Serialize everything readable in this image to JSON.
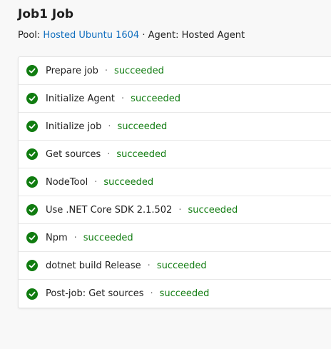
{
  "job": {
    "title": "Job1 Job",
    "pool_label": "Pool:",
    "pool_value": "Hosted Ubuntu 1604",
    "separator": "·",
    "agent_label": "Agent:",
    "agent_value": "Hosted Agent"
  },
  "colors": {
    "success": "#107c10",
    "link": "#106ebe"
  },
  "steps": [
    {
      "name": "Prepare job",
      "status": "succeeded",
      "icon": "check-circle-icon"
    },
    {
      "name": "Initialize Agent",
      "status": "succeeded",
      "icon": "check-circle-icon"
    },
    {
      "name": "Initialize job",
      "status": "succeeded",
      "icon": "check-circle-icon"
    },
    {
      "name": "Get sources",
      "status": "succeeded",
      "icon": "check-circle-icon"
    },
    {
      "name": "NodeTool",
      "status": "succeeded",
      "icon": "check-circle-icon"
    },
    {
      "name": "Use .NET Core SDK 2.1.502",
      "status": "succeeded",
      "icon": "check-circle-icon"
    },
    {
      "name": "Npm",
      "status": "succeeded",
      "icon": "check-circle-icon"
    },
    {
      "name": "dotnet build Release",
      "status": "succeeded",
      "icon": "check-circle-icon"
    },
    {
      "name": "Post-job: Get sources",
      "status": "succeeded",
      "icon": "check-circle-icon"
    }
  ],
  "step_separator": "·"
}
